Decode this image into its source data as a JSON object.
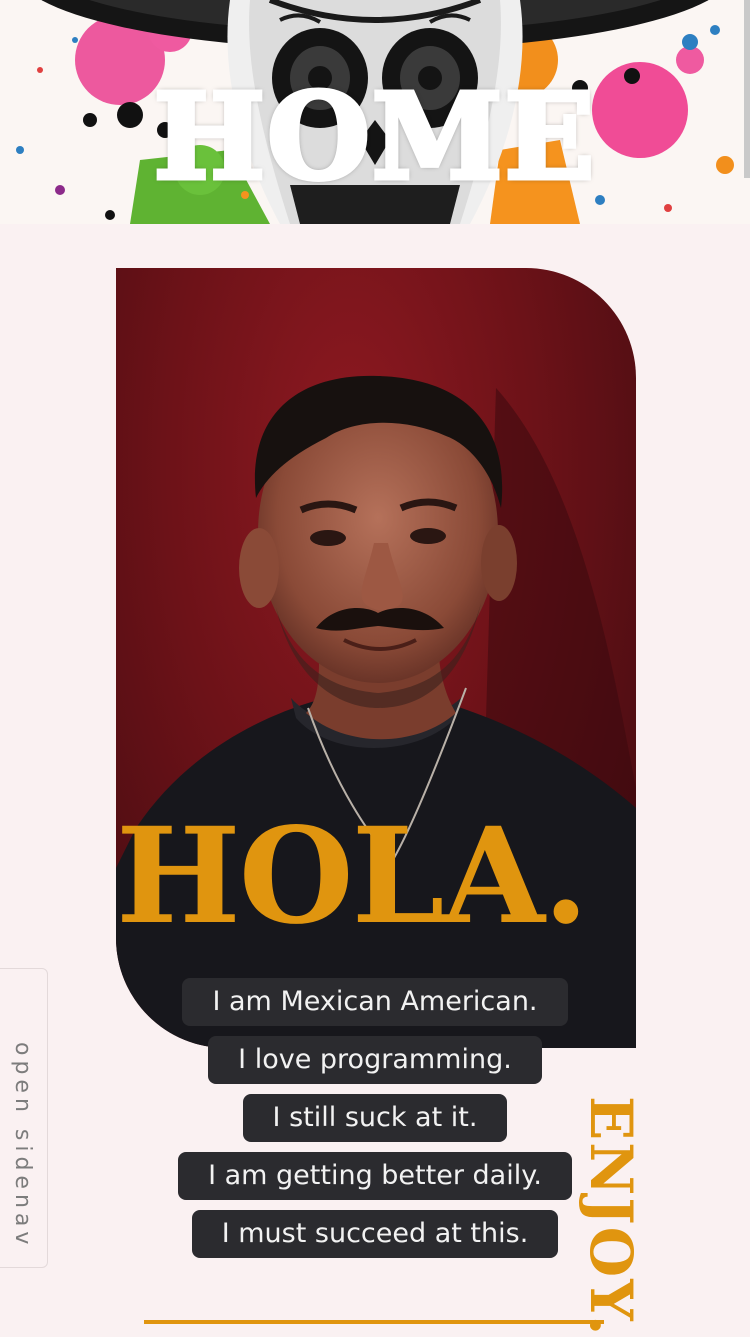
{
  "banner": {
    "title": "HOME",
    "image": "sugar-skull-paint-splatter"
  },
  "portrait": {
    "image": "portrait-photo",
    "greeting": "HOLA."
  },
  "statements": [
    "I am Mexican American.",
    "I love programming.",
    "I still suck at it.",
    "I am getting better daily.",
    "I must succeed at this."
  ],
  "sidenav": {
    "label": "open sidenav"
  },
  "footer": {
    "enjoy": "ENJOY."
  },
  "colors": {
    "accent": "#e0950f",
    "background": "#faf1f2",
    "pill": "#2b2b2f",
    "pill_text": "#f2f2f2"
  }
}
